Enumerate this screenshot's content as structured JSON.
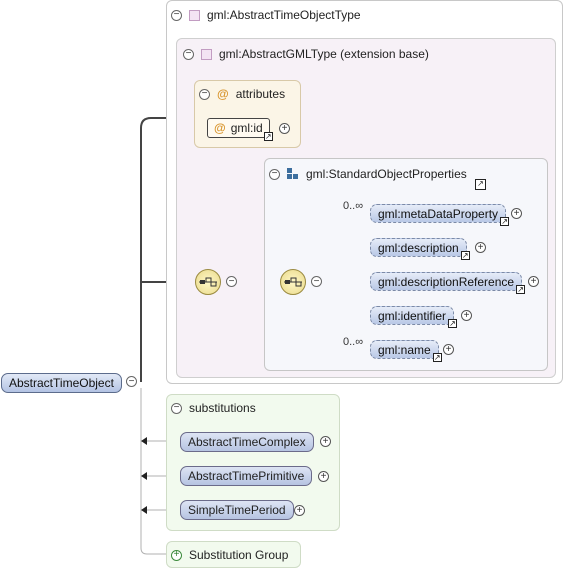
{
  "root": {
    "label": "AbstractTimeObject"
  },
  "complex_type": {
    "label": "gml:AbstractTimeObjectType"
  },
  "extension": {
    "label": "gml:AbstractGMLType (extension base)"
  },
  "attributes": {
    "label": "attributes",
    "items": [
      {
        "label": "gml:id"
      }
    ]
  },
  "std_props": {
    "label": "gml:StandardObjectProperties",
    "cardinality": "0..∞",
    "items": [
      {
        "label": "gml:metaDataProperty",
        "cardinality": "0..∞"
      },
      {
        "label": "gml:description"
      },
      {
        "label": "gml:descriptionReference"
      },
      {
        "label": "gml:identifier"
      },
      {
        "label": "gml:name",
        "cardinality": "0..∞"
      }
    ]
  },
  "substitutions": {
    "label": "substitutions",
    "items": [
      {
        "label": "AbstractTimeComplex"
      },
      {
        "label": "AbstractTimePrimitive"
      },
      {
        "label": "SimpleTimePeriod"
      }
    ]
  },
  "substitution_group": {
    "label": "Substitution Group"
  },
  "colors": {
    "element_fill": "#c7d3ee",
    "type_fill": "#f7f1f7",
    "attr_fill": "#fbf5e7",
    "subs_fill": "#f2faee"
  }
}
